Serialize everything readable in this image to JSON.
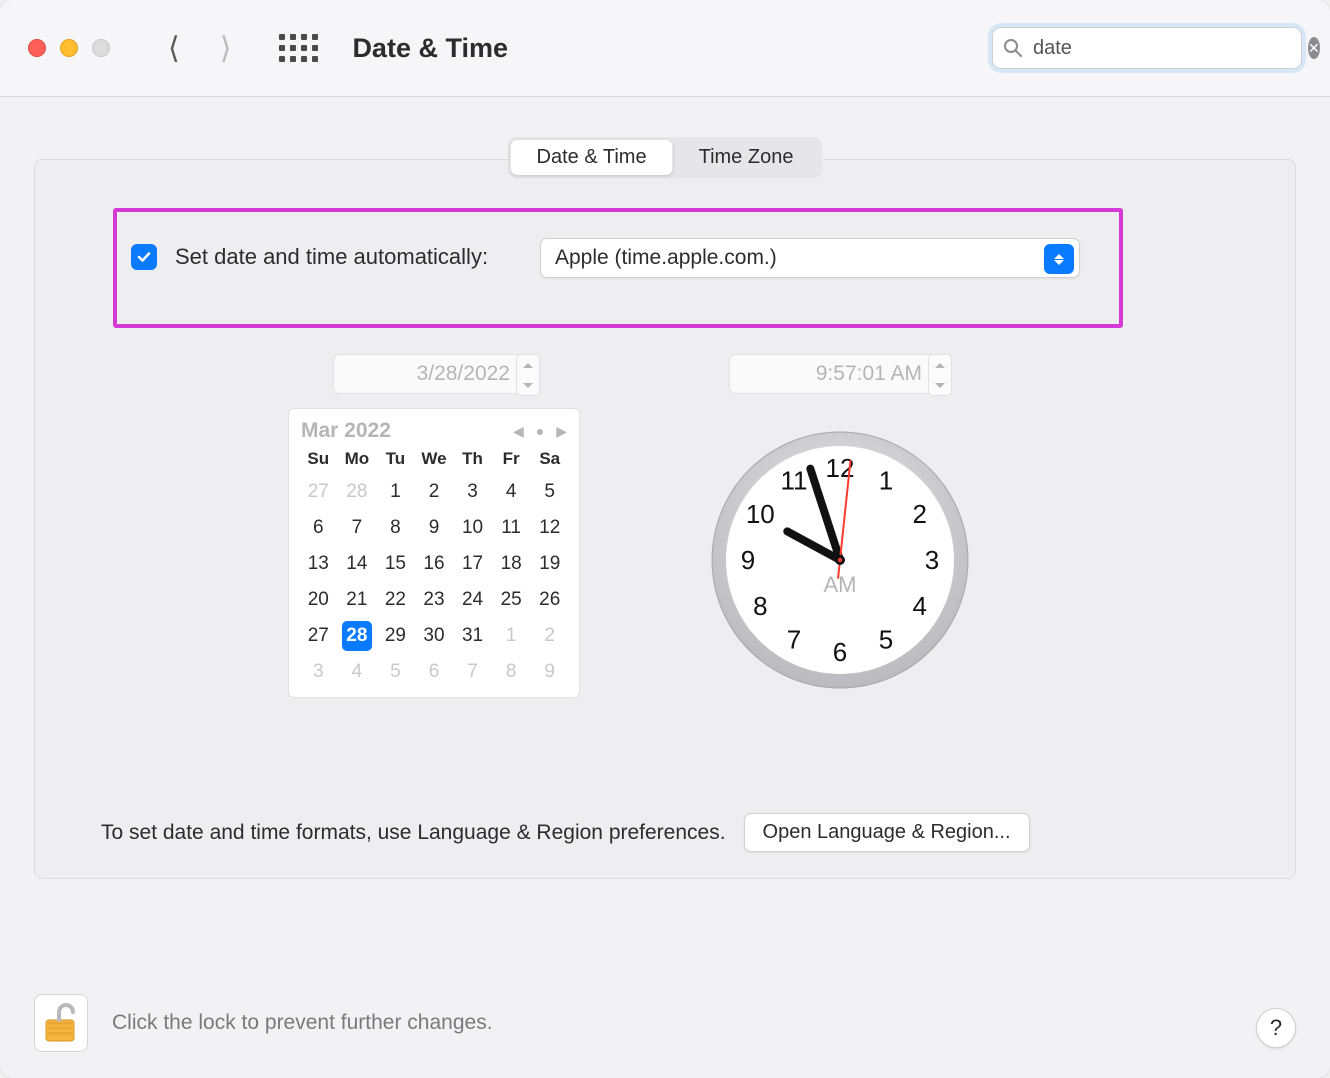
{
  "header": {
    "window_title": "Date & Time",
    "search_value": "date"
  },
  "tabs": {
    "date_time": "Date & Time",
    "time_zone": "Time Zone"
  },
  "auto": {
    "checked": true,
    "label": "Set date and time automatically:",
    "server": "Apple (time.apple.com.)"
  },
  "fields": {
    "date_value": "3/28/2022",
    "time_value": "9:57:01 AM"
  },
  "calendar": {
    "title": "Mar 2022",
    "dows": [
      "Su",
      "Mo",
      "Tu",
      "We",
      "Th",
      "Fr",
      "Sa"
    ],
    "cells": [
      {
        "n": "27",
        "muted": true
      },
      {
        "n": "28",
        "muted": true
      },
      {
        "n": "1"
      },
      {
        "n": "2"
      },
      {
        "n": "3"
      },
      {
        "n": "4"
      },
      {
        "n": "5"
      },
      {
        "n": "6"
      },
      {
        "n": "7"
      },
      {
        "n": "8"
      },
      {
        "n": "9"
      },
      {
        "n": "10"
      },
      {
        "n": "11"
      },
      {
        "n": "12"
      },
      {
        "n": "13"
      },
      {
        "n": "14"
      },
      {
        "n": "15"
      },
      {
        "n": "16"
      },
      {
        "n": "17"
      },
      {
        "n": "18"
      },
      {
        "n": "19"
      },
      {
        "n": "20"
      },
      {
        "n": "21"
      },
      {
        "n": "22"
      },
      {
        "n": "23"
      },
      {
        "n": "24"
      },
      {
        "n": "25"
      },
      {
        "n": "26"
      },
      {
        "n": "27"
      },
      {
        "n": "28",
        "today": true
      },
      {
        "n": "29"
      },
      {
        "n": "30"
      },
      {
        "n": "31"
      },
      {
        "n": "1",
        "muted": true
      },
      {
        "n": "2",
        "muted": true
      },
      {
        "n": "3",
        "muted": true
      },
      {
        "n": "4",
        "muted": true
      },
      {
        "n": "5",
        "muted": true
      },
      {
        "n": "6",
        "muted": true
      },
      {
        "n": "7",
        "muted": true
      },
      {
        "n": "8",
        "muted": true
      },
      {
        "n": "9",
        "muted": true
      }
    ]
  },
  "clock": {
    "ampm": "AM",
    "numerals": [
      "12",
      "1",
      "2",
      "3",
      "4",
      "5",
      "6",
      "7",
      "8",
      "9",
      "10",
      "11"
    ],
    "hour_angle": 298.5,
    "minute_angle": 342.0,
    "second_angle": 6.0
  },
  "footer": {
    "format_hint": "To set date and time formats, use Language & Region preferences.",
    "open_lang_region": "Open Language & Region..."
  },
  "lock": {
    "hint": "Click the lock to prevent further changes."
  },
  "help_label": "?"
}
